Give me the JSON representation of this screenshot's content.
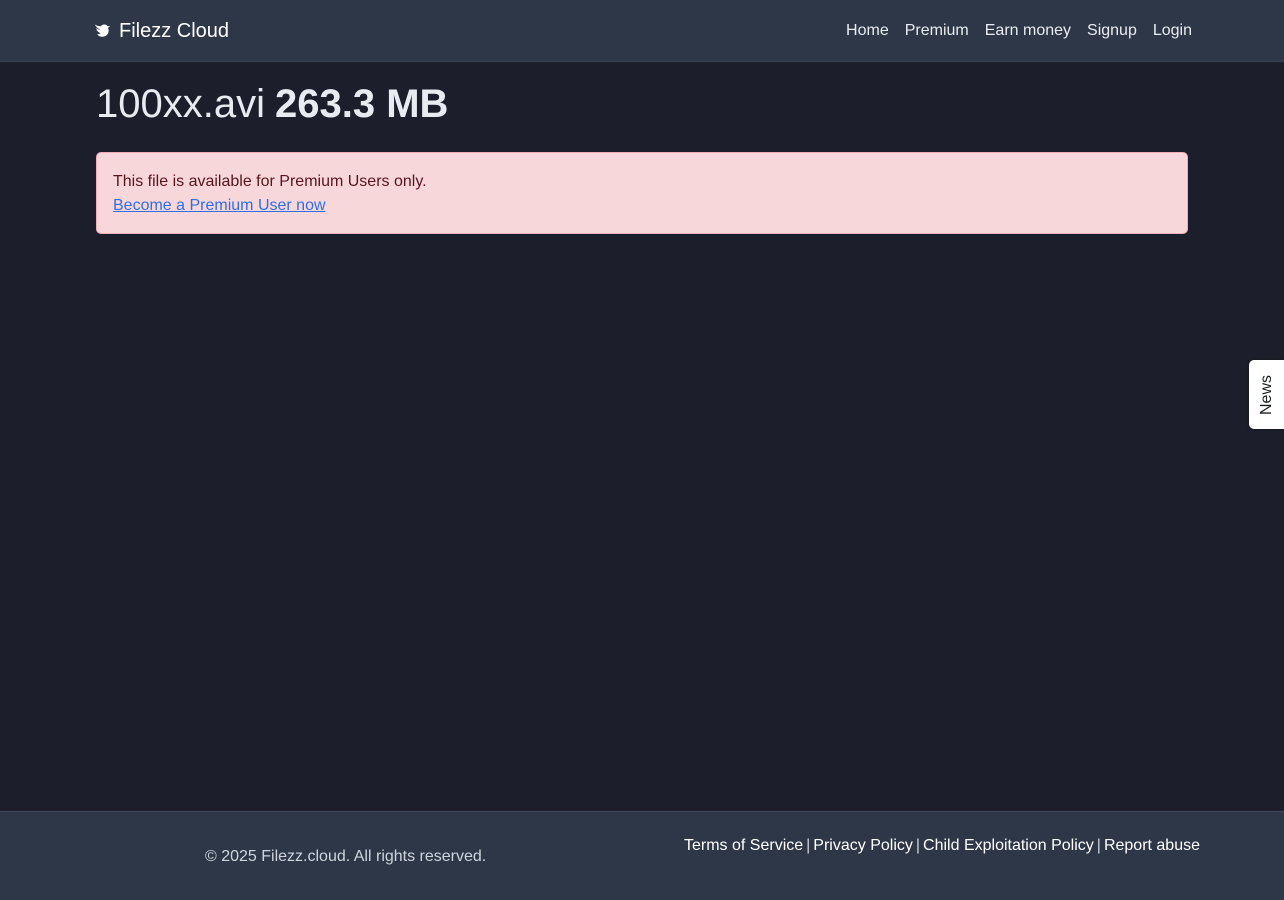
{
  "navbar": {
    "brand": "Filezz Cloud",
    "brand_icon": "dove-icon",
    "links": [
      "Home",
      "Premium",
      "Earn money",
      "Signup",
      "Login"
    ]
  },
  "file": {
    "name": "100xx.avi",
    "size": "263.3 MB"
  },
  "alert": {
    "message": "This file is available for Premium Users only.",
    "link": "Become a Premium User now"
  },
  "news_tab": {
    "label": "News"
  },
  "footer": {
    "copyright": "© 2025 Filezz.cloud. All rights reserved.",
    "links": [
      "Terms of Service",
      "Privacy Policy",
      "Child Exploitation Policy",
      "Report abuse"
    ],
    "separator": "|"
  },
  "colors": {
    "background": "#1c1f2b",
    "navbar": "#2d3748",
    "alert_bg": "#f8d7da",
    "alert_text": "#58151c",
    "link": "#2f6fe4"
  }
}
